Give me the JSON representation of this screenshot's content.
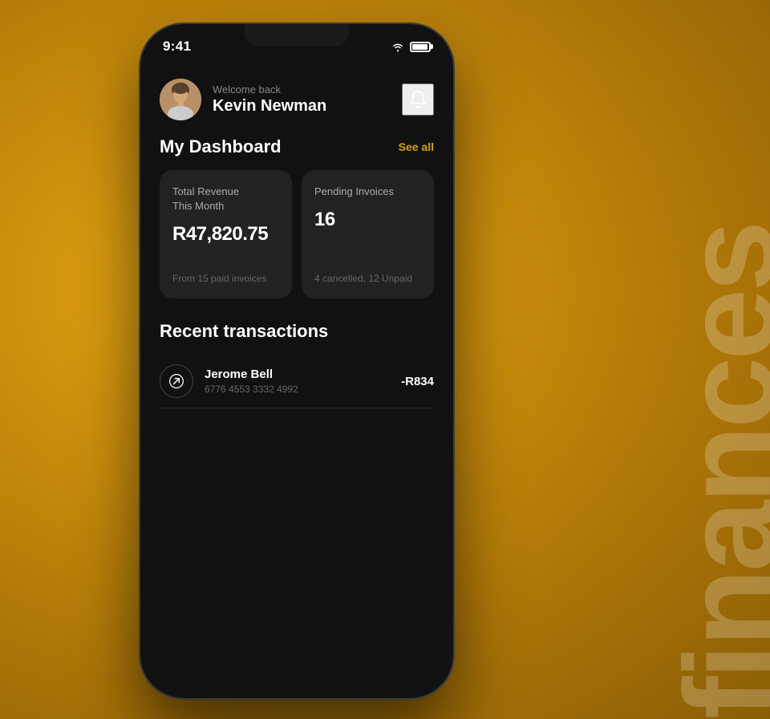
{
  "background": {
    "color": "#C8900A"
  },
  "watermark": {
    "text": "finances"
  },
  "phone": {
    "status_bar": {
      "time": "9:41",
      "wifi": "wifi",
      "battery": "battery"
    },
    "header": {
      "welcome_line1": "Welcome back",
      "welcome_line2": "Kevin Newman",
      "bell": "notification bell"
    },
    "dashboard": {
      "title": "My Dashboard",
      "see_all": "See all",
      "cards": [
        {
          "label": "Total Revenue\nThis Month",
          "value": "R47,820.75",
          "sub": "From 15 paid invoices"
        },
        {
          "label": "Pending Invoices",
          "value": "16",
          "sub": "4 cancelled, 12 Unpaid"
        }
      ]
    },
    "recent_transactions": {
      "title": "Recent transactions",
      "items": [
        {
          "name": "Jerome Bell",
          "card": "6776  4553  3332  4992",
          "amount": "-R834"
        }
      ]
    }
  }
}
